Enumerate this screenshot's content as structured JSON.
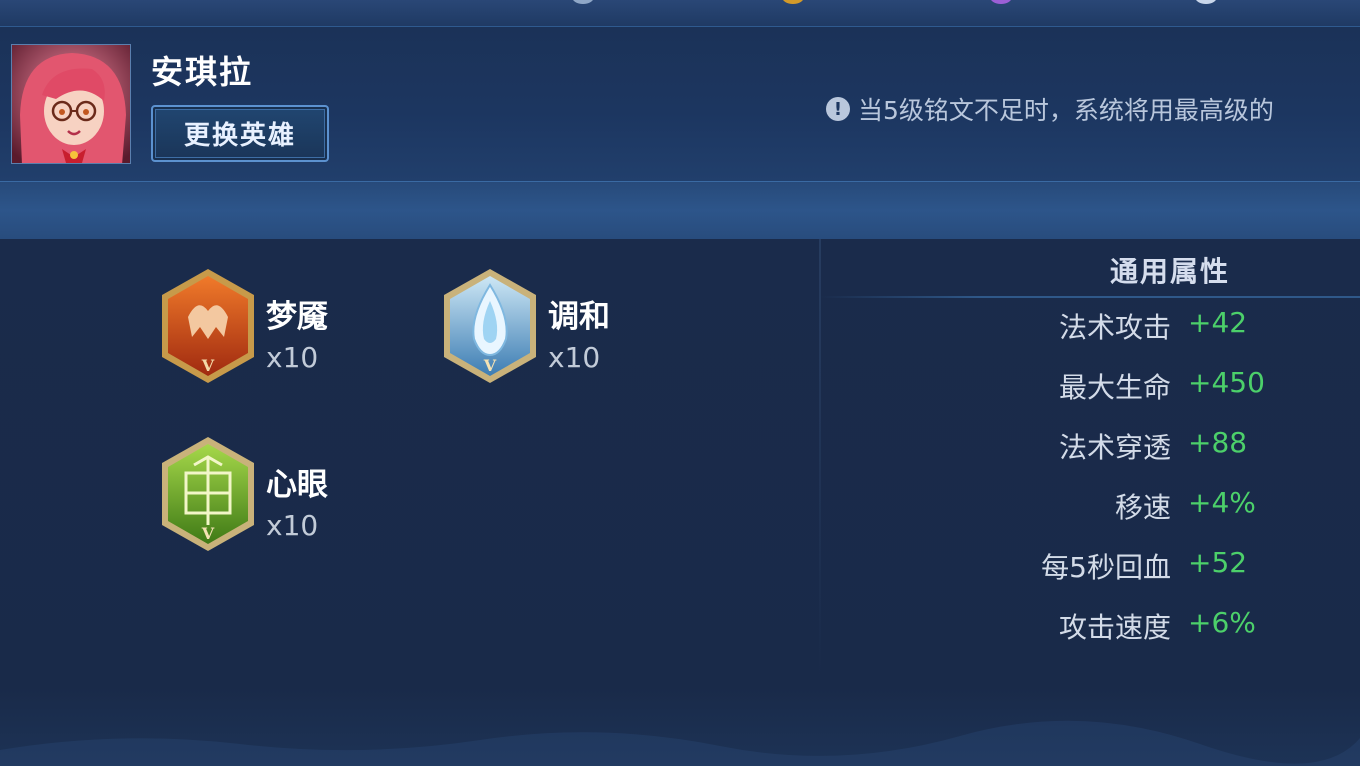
{
  "hero": {
    "name": "安琪拉",
    "change_button_label": "更换英雄"
  },
  "notice": {
    "icon": "exclamation-icon",
    "text": "当5级铭文不足时，系统将用最高级的"
  },
  "runes": [
    {
      "name": "梦魇",
      "count": "x10",
      "color": "#c2461a",
      "icon": "nightmare-rune-icon"
    },
    {
      "name": "调和",
      "count": "x10",
      "color": "#5fa7d6",
      "icon": "harmony-rune-icon"
    },
    {
      "name": "心眼",
      "count": "x10",
      "color": "#5f9a22",
      "icon": "mind-eye-rune-icon"
    }
  ],
  "attributes": {
    "title": "通用属性",
    "items": [
      {
        "label": "法术攻击",
        "value": "+42"
      },
      {
        "label": "最大生命",
        "value": "+450"
      },
      {
        "label": "法术穿透",
        "value": "+88"
      },
      {
        "label": "移速",
        "value": "+4%"
      },
      {
        "label": "每5秒回血",
        "value": "+52"
      },
      {
        "label": "攻击速度",
        "value": "+6%"
      }
    ]
  },
  "colors": {
    "accent": "#5c92d0",
    "positive": "#4cd06a",
    "background": "#1a2a4a"
  }
}
